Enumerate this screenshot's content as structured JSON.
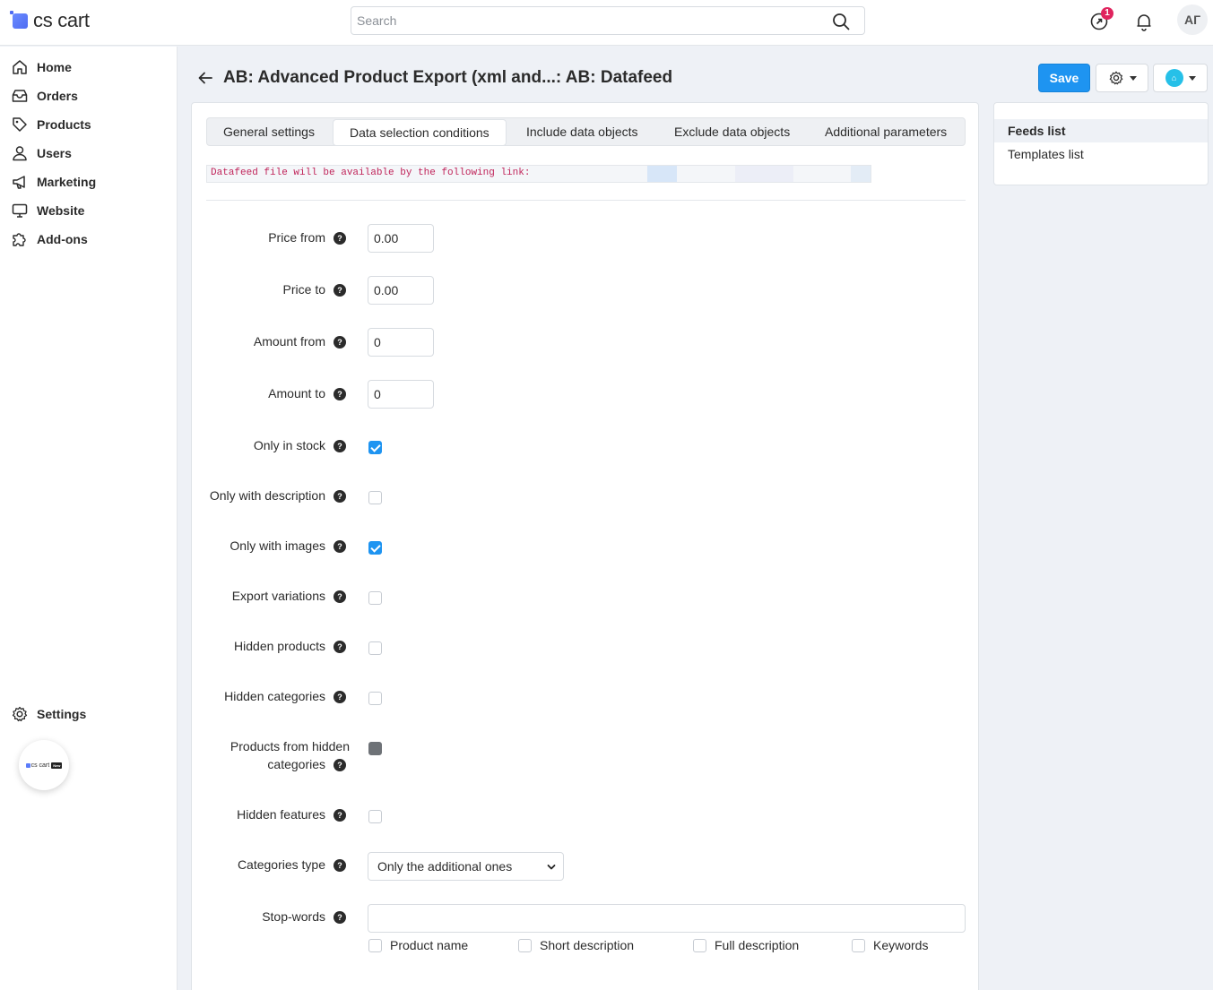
{
  "app": {
    "logo_text": "cs cart",
    "promo_text": "cs cart",
    "promo_badge": "New"
  },
  "search": {
    "placeholder": "Search",
    "value": ""
  },
  "header": {
    "notification_count": "1",
    "avatar_initials": "АГ"
  },
  "sidebar": {
    "items": [
      {
        "label": "Home",
        "icon": "home-icon"
      },
      {
        "label": "Orders",
        "icon": "orders-icon"
      },
      {
        "label": "Products",
        "icon": "tag-icon"
      },
      {
        "label": "Users",
        "icon": "user-icon"
      },
      {
        "label": "Marketing",
        "icon": "megaphone-icon"
      },
      {
        "label": "Website",
        "icon": "monitor-icon"
      },
      {
        "label": "Add-ons",
        "icon": "puzzle-icon"
      }
    ],
    "settings_label": "Settings"
  },
  "page": {
    "title": "AB: Advanced Product Export (xml and...: AB: Datafeed",
    "save_label": "Save"
  },
  "tabs": [
    {
      "label": "General settings",
      "active": false
    },
    {
      "label": "Data selection conditions",
      "active": true
    },
    {
      "label": "Include data objects",
      "active": false
    },
    {
      "label": "Exclude data objects",
      "active": false
    },
    {
      "label": "Additional parameters",
      "active": false
    }
  ],
  "link_text": "Datafeed file will be available by the following link:",
  "form": {
    "price_from": {
      "label": "Price from",
      "value": "0.00"
    },
    "price_to": {
      "label": "Price to",
      "value": "0.00"
    },
    "amount_from": {
      "label": "Amount from",
      "value": "0"
    },
    "amount_to": {
      "label": "Amount to",
      "value": "0"
    },
    "only_in_stock": {
      "label": "Only in stock",
      "checked": true
    },
    "only_with_description": {
      "label": "Only with description",
      "checked": false
    },
    "only_with_images": {
      "label": "Only with images",
      "checked": true
    },
    "export_variations": {
      "label": "Export variations",
      "checked": false
    },
    "hidden_products": {
      "label": "Hidden products",
      "checked": false
    },
    "hidden_categories": {
      "label": "Hidden categories",
      "checked": false
    },
    "products_from_hidden_categories": {
      "label_line1": "Products from hidden",
      "label_line2": "categories",
      "state": "disabled"
    },
    "hidden_features": {
      "label": "Hidden features",
      "checked": false
    },
    "categories_type": {
      "label": "Categories type",
      "value": "Only the additional ones"
    },
    "stop_words": {
      "label": "Stop-words",
      "value": "",
      "options": [
        "Product name",
        "Short description",
        "Full description",
        "Keywords"
      ]
    },
    "help_glyph": "?"
  },
  "side_panel": {
    "items": [
      {
        "label": "Feeds list",
        "active": true
      },
      {
        "label": "Templates list",
        "active": false
      }
    ]
  },
  "colors": {
    "accent": "#1e94f1",
    "badge": "#e0245e",
    "link_text": "#c0245a"
  }
}
